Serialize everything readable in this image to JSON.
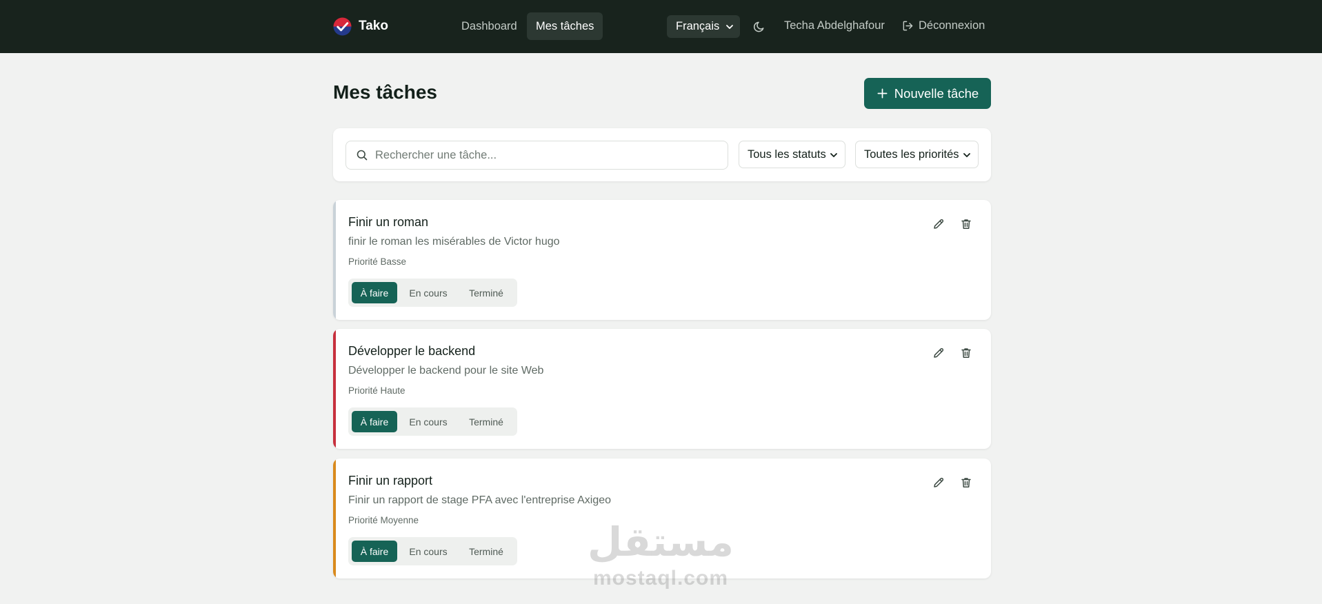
{
  "app": {
    "name": "Tako"
  },
  "nav": {
    "links": [
      {
        "label": "Dashboard",
        "active": false
      },
      {
        "label": "Mes tâches",
        "active": true
      }
    ],
    "language": "Français",
    "user": "Techa Abdelghafour",
    "logout": "Déconnexion"
  },
  "page": {
    "title": "Mes tâches",
    "new_task_label": "Nouvelle tâche"
  },
  "filters": {
    "search_placeholder": "Rechercher une tâche...",
    "search_value": "",
    "status": "Tous les statuts",
    "priority": "Toutes les priorités"
  },
  "statuses": [
    "À faire",
    "En cours",
    "Terminé"
  ],
  "tasks": [
    {
      "title": "Finir un roman",
      "description": "finir le roman les misérables de Victor hugo",
      "priority": "Priorité Basse",
      "accent": "#c9d2d8",
      "status": "À faire"
    },
    {
      "title": "Développer le backend",
      "description": "Développer le backend pour le site Web",
      "priority": "Priorité Haute",
      "accent": "#c7303d",
      "status": "À faire"
    },
    {
      "title": "Finir un rapport",
      "description": "Finir un rapport de stage PFA avec l'entreprise Axigeo",
      "priority": "Priorité Moyenne",
      "accent": "#d98a1d",
      "status": "À faire"
    }
  ],
  "colors": {
    "navbar": "#18231d",
    "primary": "#166356",
    "background": "#f1f2f1"
  },
  "watermark": {
    "arabic": "مستقل",
    "latin": "mostaql.com"
  }
}
